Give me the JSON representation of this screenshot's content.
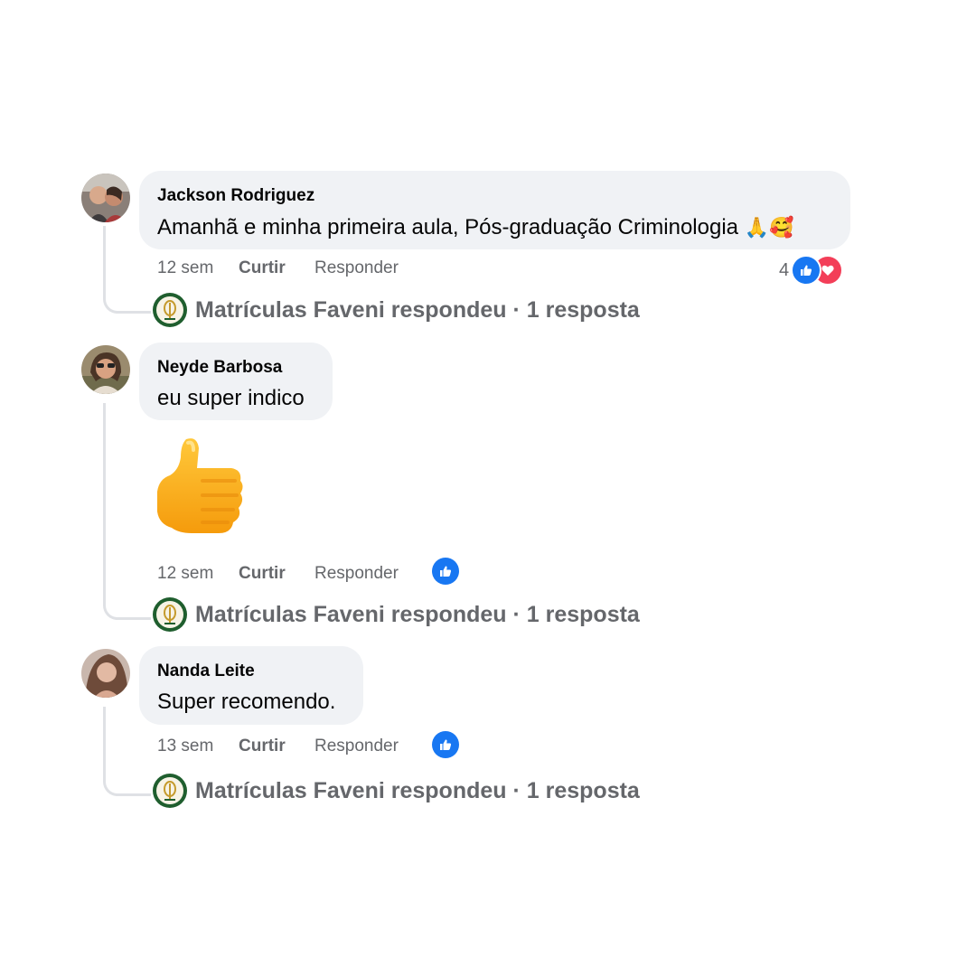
{
  "comments": [
    {
      "author": "Jackson Rodriguez",
      "text": "Amanhã e minha primeira aula, Pós-graduação Criminologia",
      "emojis": "🙏🥰",
      "time": "12 sem",
      "like_label": "Curtir",
      "reply_label": "Responder",
      "reaction_count": "4",
      "reactions": [
        "like",
        "love"
      ],
      "reply_summary": "Matrículas Faveni respondeu · 1 resposta"
    },
    {
      "author": "Neyde Barbosa",
      "text": "eu super indico",
      "sticker": "thumbs-up",
      "time": "12 sem",
      "like_label": "Curtir",
      "reply_label": "Responder",
      "reactions": [
        "like"
      ],
      "reply_summary": "Matrículas Faveni respondeu · 1 resposta"
    },
    {
      "author": "Nanda Leite",
      "text": "Super recomendo.",
      "time": "13 sem",
      "like_label": "Curtir",
      "reply_label": "Responder",
      "reactions": [
        "like"
      ],
      "reply_summary": "Matrículas Faveni respondeu · 1 resposta"
    }
  ],
  "colors": {
    "bubble": "#f0f2f5",
    "meta_text": "#65676b",
    "like_blue": "#1877f2",
    "love_red": "#f33e58",
    "faveni_green": "#1f5e2e"
  }
}
